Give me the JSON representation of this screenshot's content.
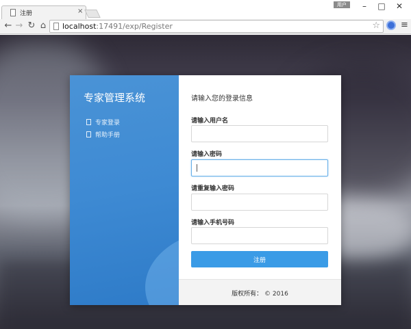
{
  "browser": {
    "tab_title": "注册",
    "tab_close": "×",
    "profile_label": "用户",
    "url_host": "localhost",
    "url_path": ":17491/exp/Register",
    "star": "☆",
    "menu": "≡",
    "nav_back": "←",
    "nav_forward": "→",
    "nav_reload": "↻",
    "nav_home": "⌂",
    "win_min": "–",
    "win_max": "□",
    "win_close": "✕"
  },
  "sidebar": {
    "brand": "专家管理系统",
    "links": [
      {
        "label": "专家登录",
        "icon": "file-icon"
      },
      {
        "label": "帮助手册",
        "icon": "file-icon"
      }
    ]
  },
  "form": {
    "heading": "请输入您的登录信息",
    "fields": [
      {
        "label": "请输入用户名",
        "value": "",
        "placeholder": ""
      },
      {
        "label": "请输入密码",
        "value": "",
        "placeholder": ""
      },
      {
        "label": "请重复输入密码",
        "value": "",
        "placeholder": ""
      },
      {
        "label": "请输入手机号码",
        "value": "",
        "placeholder": ""
      }
    ],
    "submit_label": "注册"
  },
  "footer": {
    "copyright": "版权所有： © 2016"
  },
  "colors": {
    "sidebar_blue": "#3e8ad3",
    "button_blue": "#3a9be6",
    "focus_border": "#66afe9"
  }
}
